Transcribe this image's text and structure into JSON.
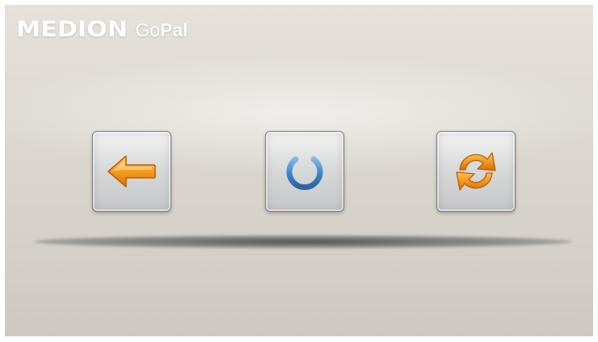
{
  "brand": {
    "name": "MEDION",
    "product_prefix": "Go",
    "product_suffix": "Pal"
  },
  "buttons": [
    {
      "id": "back",
      "icon": "back-arrow-icon",
      "color": "#f39a1c"
    },
    {
      "id": "power",
      "icon": "power-icon",
      "color": "#3f86c7"
    },
    {
      "id": "sync",
      "icon": "refresh-icon",
      "color": "#f39a1c"
    }
  ],
  "colors": {
    "background": "#dcd8d0",
    "accent_orange": "#f39a1c",
    "accent_blue": "#3f86c7"
  }
}
